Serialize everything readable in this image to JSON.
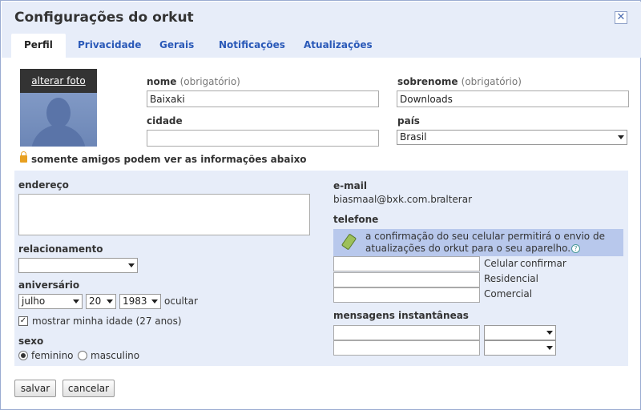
{
  "dialog": {
    "title": "Configurações do orkut",
    "close_symbol": "✕"
  },
  "tabs": [
    {
      "label": "Perfil"
    },
    {
      "label": "Privacidade"
    },
    {
      "label": "Gerais"
    },
    {
      "label": "Notificações"
    },
    {
      "label": "Atualizações"
    }
  ],
  "photo": {
    "change_label": "alterar foto"
  },
  "fields": {
    "nome": {
      "label": "nome",
      "hint": "(obrigatório)",
      "value": "Baixaki"
    },
    "sobrenome": {
      "label": "sobrenome",
      "hint": "(obrigatório)",
      "value": "Downloads"
    },
    "cidade": {
      "label": "cidade",
      "value": ""
    },
    "pais": {
      "label": "país",
      "value": "Brasil"
    }
  },
  "privacy_notice": "somente amigos podem ver as informações abaixo",
  "endereco": {
    "label": "endereço"
  },
  "relacionamento": {
    "label": "relacionamento",
    "value": ""
  },
  "aniversario": {
    "label": "aniversário",
    "month": "julho",
    "day": "20",
    "year": "1983",
    "hide_link": "ocultar"
  },
  "show_age": {
    "label": "mostrar minha idade (27 anos)",
    "checked": true,
    "check_symbol": "✓"
  },
  "sexo": {
    "label": "sexo",
    "options": [
      "feminino",
      "masculino"
    ],
    "selected": "feminino"
  },
  "email": {
    "label": "e-mail",
    "value": "biasmaal@bxk.com.br",
    "change_link": "alterar"
  },
  "telefone": {
    "label": "telefone",
    "notice": "a confirmação do seu celular permitirá o envio de atualizações do orkut para o seu aparelho.",
    "help_symbol": "?",
    "celular": "Celular",
    "confirm_link": "confirmar",
    "residencial": "Residencial",
    "comercial": "Comercial"
  },
  "im": {
    "label": "mensagens instantâneas"
  },
  "buttons": {
    "save": "salvar",
    "cancel": "cancelar"
  },
  "colors": {
    "accent_link": "#2a59b8",
    "header_bg": "#e7edf9",
    "notice_bg": "#b8c8ec"
  }
}
